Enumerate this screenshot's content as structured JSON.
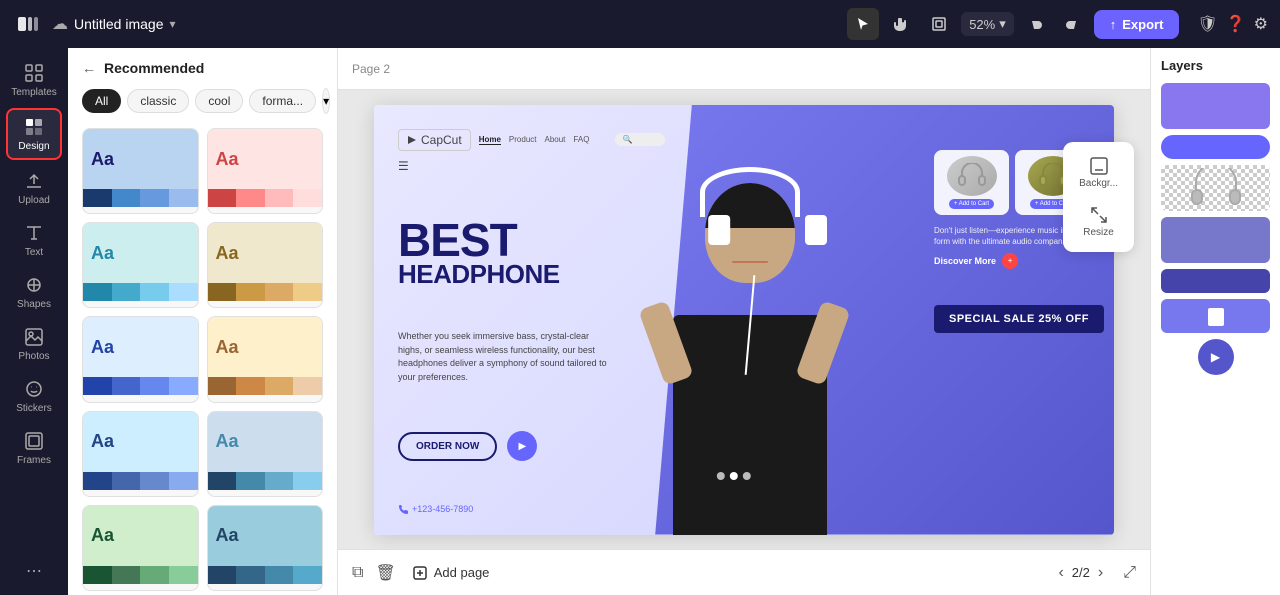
{
  "topbar": {
    "logo": "✕",
    "back_label": "Recommended",
    "cloud_icon": "☁",
    "title": "Untitled image",
    "chevron": "▾",
    "cursor_tool": "▶",
    "hand_tool": "✋",
    "frame_icon": "⬜",
    "zoom_level": "52%",
    "zoom_chevron": "▾",
    "undo_icon": "↺",
    "redo_icon": "↻",
    "export_label": "Export",
    "export_icon": "↑",
    "shield_icon": "🛡",
    "help_icon": "?",
    "settings_icon": "⚙"
  },
  "sidebar": {
    "items": [
      {
        "label": "Templates",
        "icon": "templates"
      },
      {
        "label": "Design",
        "icon": "design",
        "active": true
      },
      {
        "label": "Upload",
        "icon": "upload"
      },
      {
        "label": "Text",
        "icon": "text"
      },
      {
        "label": "Shapes",
        "icon": "shapes"
      },
      {
        "label": "Photos",
        "icon": "photos"
      },
      {
        "label": "Stickers",
        "icon": "stickers"
      },
      {
        "label": "Frames",
        "icon": "frames"
      }
    ]
  },
  "panel": {
    "back_label": "← Recommended",
    "title": "Recommended",
    "filters": [
      "All",
      "classic",
      "cool",
      "forma..."
    ],
    "more_btn": "▾"
  },
  "themes": [
    {
      "text": "Aa",
      "text_color": "#1a1a2e",
      "bg": "#b8d4f0",
      "colors": [
        "#1a3a6e",
        "#4488cc",
        "#6699dd",
        "#99bbee"
      ]
    },
    {
      "text": "Aa",
      "text_color": "#cc4444",
      "bg": "#ffe4e4",
      "colors": [
        "#cc4444",
        "#ff8888",
        "#ffbbbb",
        "#ffdddd"
      ]
    },
    {
      "text": "Aa",
      "text_color": "#2288aa",
      "bg": "#cceeee",
      "colors": [
        "#2288aa",
        "#44aacc",
        "#77ccee",
        "#aaddff"
      ]
    },
    {
      "text": "Aa",
      "text_color": "#886622",
      "bg": "#f0e8cc",
      "colors": [
        "#886622",
        "#cc9944",
        "#ddaa66",
        "#eecc88"
      ]
    },
    {
      "text": "Aa",
      "text_color": "#2244aa",
      "bg": "#ddeeff",
      "colors": [
        "#2244aa",
        "#4466cc",
        "#6688ee",
        "#88aaff"
      ]
    },
    {
      "text": "Aa",
      "text_color": "#996633",
      "bg": "#fff0cc",
      "colors": [
        "#996633",
        "#cc8844",
        "#ddaa66",
        "#eeccaa"
      ]
    },
    {
      "text": "Aa",
      "text_color": "#224488",
      "bg": "#cceeff",
      "colors": [
        "#224488",
        "#4466aa",
        "#6688cc",
        "#88aaee"
      ]
    },
    {
      "text": "Aa",
      "text_color": "#4488aa",
      "bg": "#ccddee",
      "colors": [
        "#224466",
        "#4488aa",
        "#66aacc",
        "#88ccee"
      ]
    },
    {
      "text": "Aa",
      "text_color": "#1a5533",
      "bg": "#d0eecc",
      "colors": [
        "#1a5533",
        "#447755",
        "#66aa77",
        "#88cc99"
      ]
    },
    {
      "text": "Aa",
      "text_color": "#224466",
      "bg": "#99ccdd",
      "colors": [
        "#224466",
        "#336688",
        "#4488aa",
        "#55aacc"
      ]
    }
  ],
  "canvas": {
    "page_label": "Page 2",
    "expand_icon": "⛶"
  },
  "mini_toolbar": {
    "backgr_label": "Backgr...",
    "resize_label": "Resize"
  },
  "ad": {
    "logo": "CapCut",
    "nav_links": [
      "Home",
      "Product",
      "About",
      "FAQ"
    ],
    "heading_line1": "BEST",
    "heading_line2": "HEADPHONE",
    "subtext": "Whether you seek immersive bass, crystal-clear highs, or seamless wireless functionality, our best headphones deliver a symphony of sound tailored to your preferences.",
    "order_btn": "ORDER NOW",
    "phone": "+123-456-7890",
    "desc": "Don't just listen—experience music in its purest form with the ultimate audio companions.",
    "discover_more": "Discover More",
    "add_to_cart": "+ Add to Cart",
    "special_sale": "SPECIAL SALE 25% OFF"
  },
  "layers": {
    "title": "Layers"
  },
  "bottom_bar": {
    "add_page": "Add page",
    "page_indicator": "2/2"
  }
}
